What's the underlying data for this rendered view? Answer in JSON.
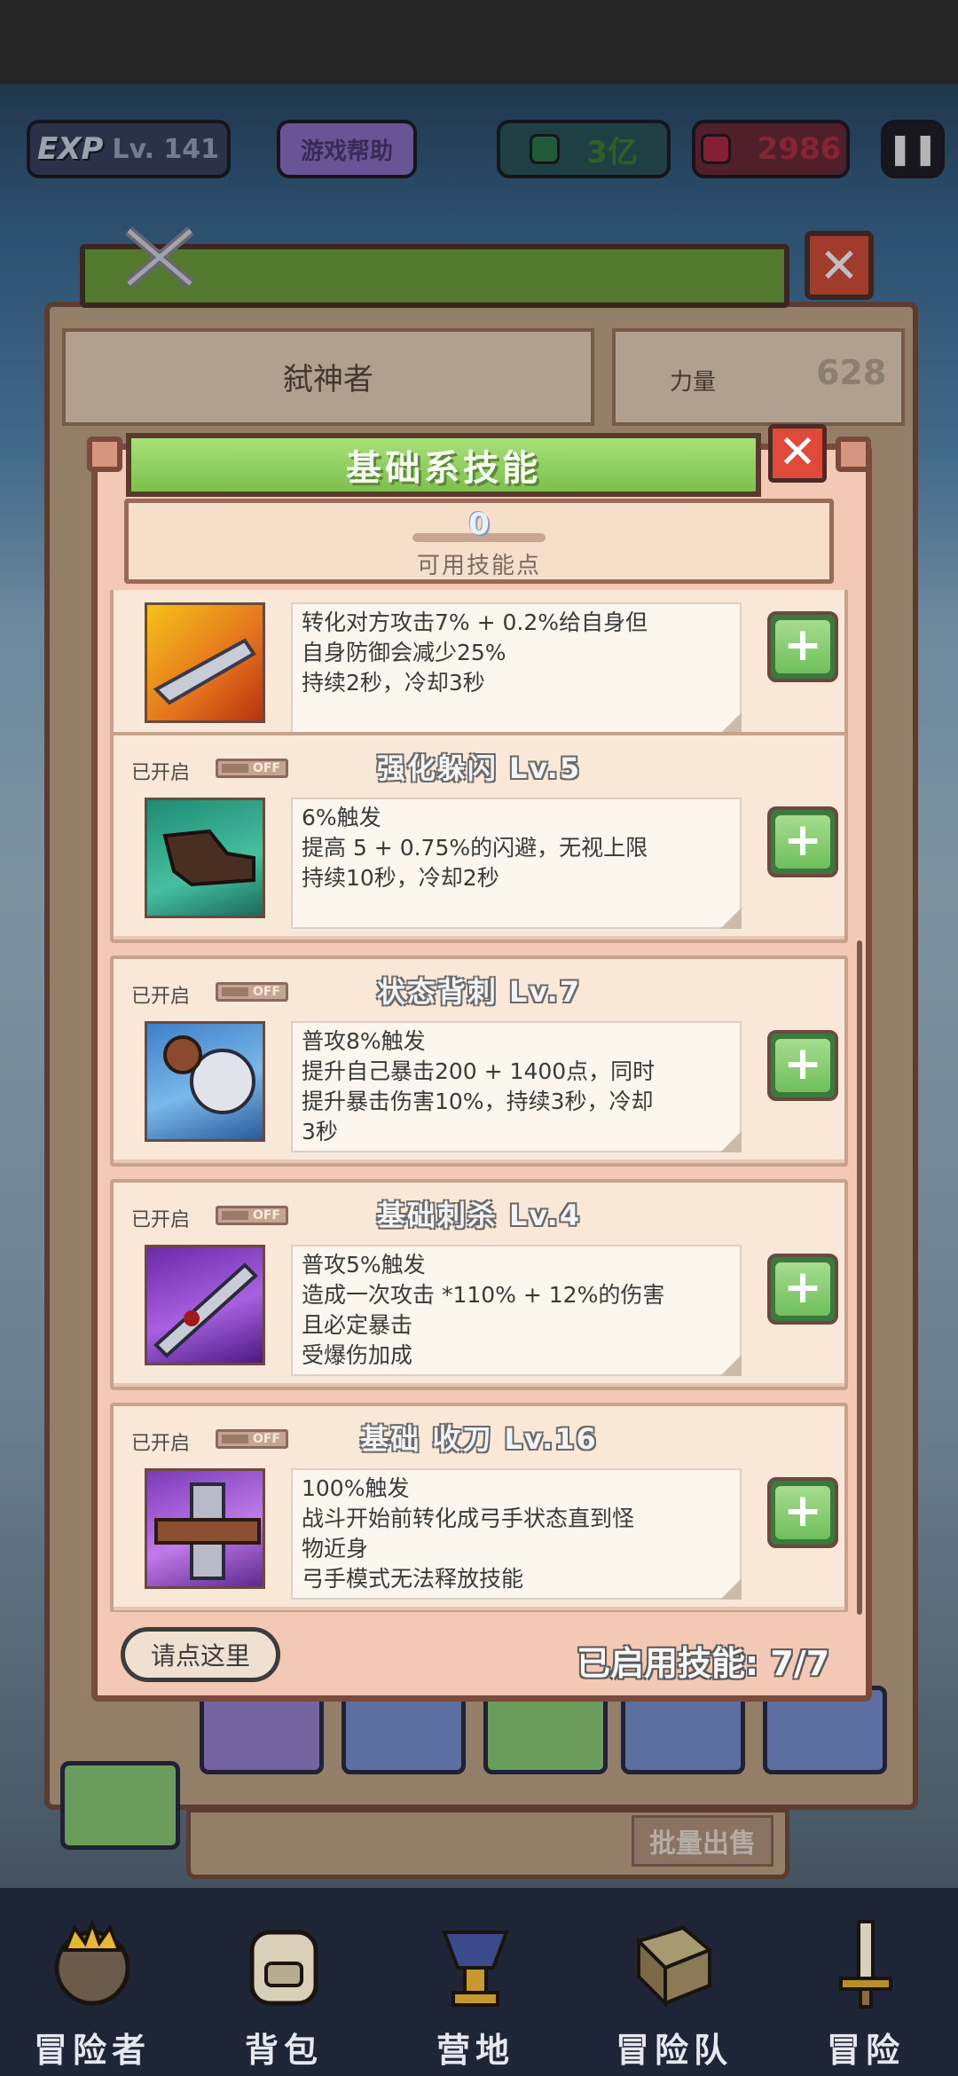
{
  "hud": {
    "exp_label": "EXP",
    "level": "Lv. 141",
    "help_button": "游戏帮助",
    "green_currency": "3亿",
    "red_currency": "2986",
    "pause_icon": "pause-icon"
  },
  "background_panel": {
    "character_name": "弑神者",
    "stat_label": "力量",
    "stat_value": "628",
    "bulk_sell": "批量出售"
  },
  "modal": {
    "title": "基础系技能",
    "skill_points": "0",
    "skill_points_label": "可用技能点",
    "help_button": "请点这里",
    "enabled_skills": "已启用技能: 7/7"
  },
  "skills": [
    {
      "status": "",
      "toggle": "",
      "title": "",
      "desc": [
        "转化对方攻击7% + 0.2%给自身但",
        "自身防御会减少25%",
        "持续2秒，冷却3秒"
      ],
      "icon": "sword-burst-icon"
    },
    {
      "status": "已开启",
      "toggle": "OFF",
      "title": "强化躲闪 Lv.5",
      "desc": [
        "6%触发",
        "提高 5 + 0.75%的闪避，无视上限",
        "持续10秒，冷却2秒"
      ],
      "icon": "dodge-boot-icon"
    },
    {
      "status": "已开启",
      "toggle": "OFF",
      "title": "状态背刺 Lv.7",
      "desc": [
        "普攻8%触发",
        "提升自己暴击200 + 1400点，同时",
        "提升暴击伤害10%，持续3秒，冷却",
        "3秒"
      ],
      "icon": "assassin-icon"
    },
    {
      "status": "已开启",
      "toggle": "OFF",
      "title": "基础刺杀 Lv.4",
      "desc": [
        "普攻5%触发",
        "造成一次攻击 *110% + 12%的伤害",
        "且必定暴击",
        "受爆伤加成"
      ],
      "icon": "bloody-sword-icon"
    },
    {
      "status": "已开启",
      "toggle": "OFF",
      "title": "基础 收刀 Lv.16",
      "desc": [
        "100%触发",
        "战斗开始前转化成弓手状态直到怪",
        "物近身",
        "弓手模式无法释放技能"
      ],
      "icon": "sheathe-sword-icon"
    }
  ],
  "bottom_nav": [
    {
      "label": "冒险者",
      "icon": "crown-helmet-icon"
    },
    {
      "label": "背包",
      "icon": "backpack-icon"
    },
    {
      "label": "营地",
      "icon": "camp-trophy-icon"
    },
    {
      "label": "冒险队",
      "icon": "guild-book-icon"
    },
    {
      "label": "冒险",
      "icon": "sword-adventure-icon"
    }
  ]
}
